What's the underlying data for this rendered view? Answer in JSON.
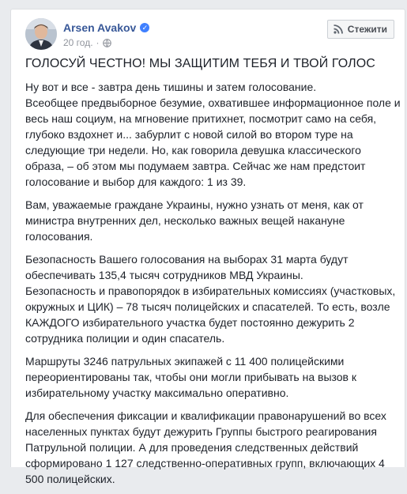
{
  "post": {
    "author": "Arsen Avakov",
    "timestamp": "20 год.",
    "follow_label": "Стежити",
    "icons": {
      "verified": "verified-badge-icon",
      "audience": "globe-icon",
      "follow": "follow-rss-icon"
    },
    "headline": "ГОЛОСУЙ ЧЕСТНО! МЫ ЗАЩИТИМ ТЕБЯ И ТВОЙ ГОЛОС",
    "paragraphs": [
      [
        "Ну вот и все - завтра день тишины и затем голосование.",
        "Всеобщее предвыборное безумие, охватившее информационное поле и весь наш социум, на мгновение притихнет, посмотрит само на себя, глубоко вздохнет и... забурлит с новой силой во втором туре на следующие три недели. Но, как говорила девушка классического образа, – об этом мы подумаем завтра. Сейчас же нам предстоит голосование и выбор для каждого: 1 из 39."
      ],
      [
        "Вам, уважаемые граждане Украины, нужно узнать от меня, как от министра внутренних дел, несколько важных вещей накануне голосования."
      ],
      [
        "Безопасность Вашего голосования на выборах 31 марта будут обеспечивать 135,4 тысяч сотрудников МВД Украины.",
        "Безопасность и правопорядок в избирательных комиссиях (участковых, окружных и ЦИК) – 78 тысяч полицейских и спасателей. То есть, возле КАЖДОГО избирательного участка будет постоянно дежурить 2 сотрудника полиции и один спасатель."
      ],
      [
        "Маршруты 3246 патрульных экипажей с 11 400 полицейскими переориентированы так, чтобы они могли прибывать на вызов к избирательному участку максимально оперативно."
      ],
      [
        "Для обеспечения фиксации и квалификации правонарушений во всех населенных пунктах будут дежурить Группы быстрого реагирования Патрульной полиции. А для проведения следственных действий сформировано 1 127 следственно-оперативных групп, включающих 4 500 полицейских."
      ]
    ]
  },
  "colors": {
    "author": "#385898",
    "text": "#1d2129",
    "meta": "#90949c",
    "page_bg": "#e9ebee"
  }
}
